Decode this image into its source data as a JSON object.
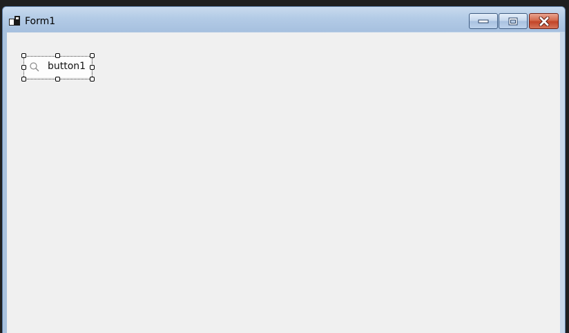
{
  "window": {
    "title": "Form1",
    "icon": "form-designer-icon"
  },
  "caption_buttons": {
    "minimize_icon": "minimize-icon",
    "maximize_icon": "maximize-icon",
    "close_icon": "close-icon",
    "close_color": "#c9482d"
  },
  "designer": {
    "button1": {
      "label": "button1",
      "icon": "search-icon",
      "selected": true
    }
  }
}
